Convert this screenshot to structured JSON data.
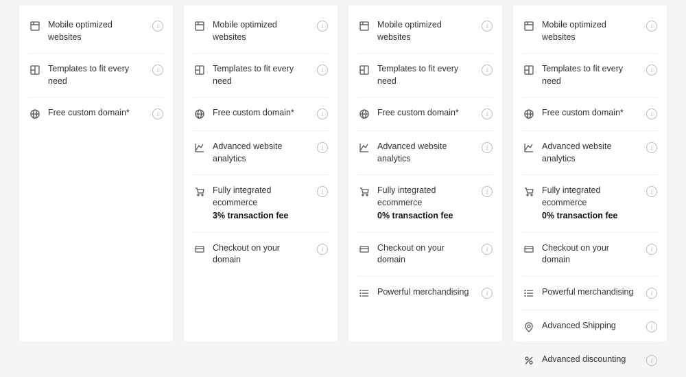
{
  "features": {
    "mobile": {
      "icon": "mobile",
      "label": "Mobile optimized websites"
    },
    "templates": {
      "icon": "templates",
      "label": "Templates to fit every need"
    },
    "domain": {
      "icon": "globe",
      "label": "Free custom domain*"
    },
    "analytics": {
      "icon": "analytics",
      "label": "Advanced website analytics"
    },
    "ecom3": {
      "icon": "cart",
      "label": "Fully integrated ecommerce",
      "sub": "3% transaction fee"
    },
    "ecom0": {
      "icon": "cart",
      "label": "Fully integrated ecommerce",
      "sub": "0% transaction fee"
    },
    "checkout": {
      "icon": "card",
      "label": "Checkout on your domain"
    },
    "merch": {
      "icon": "list",
      "label": "Powerful merchandising"
    },
    "shipping": {
      "icon": "pin",
      "label": "Advanced Shipping"
    },
    "discount": {
      "icon": "percent",
      "label": "Advanced discounting"
    }
  },
  "plans": [
    {
      "features": [
        "mobile",
        "templates",
        "domain"
      ]
    },
    {
      "features": [
        "mobile",
        "templates",
        "domain",
        "analytics",
        "ecom3",
        "checkout"
      ]
    },
    {
      "features": [
        "mobile",
        "templates",
        "domain",
        "analytics",
        "ecom0",
        "checkout",
        "merch"
      ]
    },
    {
      "features": [
        "mobile",
        "templates",
        "domain",
        "analytics",
        "ecom0",
        "checkout",
        "merch",
        "shipping",
        "discount"
      ]
    }
  ],
  "info_glyph": "i"
}
